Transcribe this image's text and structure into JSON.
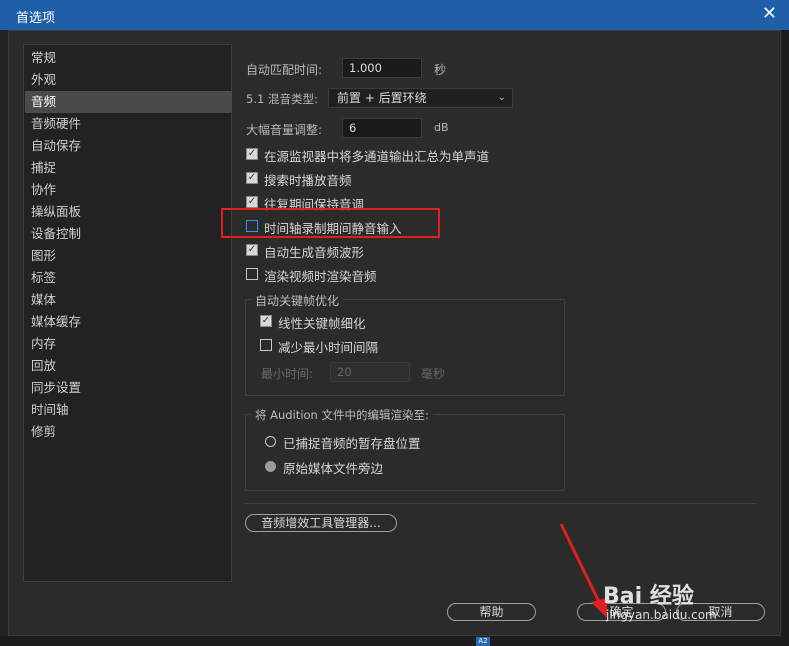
{
  "window": {
    "title": "首选项",
    "close_glyph": "✕"
  },
  "sidebar": {
    "items": [
      {
        "label": "常规",
        "selected": false
      },
      {
        "label": "外观",
        "selected": false
      },
      {
        "label": "音频",
        "selected": true
      },
      {
        "label": "音频硬件",
        "selected": false
      },
      {
        "label": "自动保存",
        "selected": false
      },
      {
        "label": "捕捉",
        "selected": false
      },
      {
        "label": "协作",
        "selected": false
      },
      {
        "label": "操纵面板",
        "selected": false
      },
      {
        "label": "设备控制",
        "selected": false
      },
      {
        "label": "图形",
        "selected": false
      },
      {
        "label": "标签",
        "selected": false
      },
      {
        "label": "媒体",
        "selected": false
      },
      {
        "label": "媒体缓存",
        "selected": false
      },
      {
        "label": "内存",
        "selected": false
      },
      {
        "label": "回放",
        "selected": false
      },
      {
        "label": "同步设置",
        "selected": false
      },
      {
        "label": "时间轴",
        "selected": false
      },
      {
        "label": "修剪",
        "selected": false
      }
    ]
  },
  "audio": {
    "auto_match": {
      "label": "自动匹配时间:",
      "value": "1.000",
      "unit": "秒"
    },
    "mix_type": {
      "label": "5.1 混音类型:",
      "value": "前置 + 后置环绕"
    },
    "large_volume": {
      "label": "大幅音量调整:",
      "value": "6",
      "unit": "dB"
    },
    "checkboxes": [
      {
        "label": "在源监视器中将多通道输出汇总为单声道",
        "checked": true
      },
      {
        "label": "搜索时播放音频",
        "checked": true
      },
      {
        "label": "往复期间保持音调",
        "checked": true
      },
      {
        "label": "时间轴录制期间静音输入",
        "checked": false
      },
      {
        "label": "自动生成音频波形",
        "checked": true
      },
      {
        "label": "渲染视频时渲染音频",
        "checked": false
      }
    ],
    "keyframe_group": {
      "title": "自动关键帧优化",
      "linear": {
        "label": "线性关键帧细化",
        "checked": true
      },
      "reduce": {
        "label": "减少最小时间间隔",
        "checked": false
      },
      "min_time": {
        "label": "最小时间:",
        "value": "20",
        "unit": "毫秒"
      }
    },
    "render_group": {
      "title": "将 Audition 文件中的编辑渲染至:",
      "options": [
        {
          "label": "已捕捉音频的暂存盘位置",
          "selected": false
        },
        {
          "label": "原始媒体文件旁边",
          "selected": true
        }
      ]
    },
    "plugin_manager_button": "音频增效工具管理器..."
  },
  "footer": {
    "help": "帮助",
    "ok": "确定",
    "cancel": "取消"
  },
  "watermark": {
    "brand": "Bai 经验",
    "url": "jingyan.baidu.com"
  },
  "bottom_tag": "A2",
  "colors": {
    "titlebar": "#1e5fa8",
    "annotation_red": "#e02020",
    "focus_blue": "#3d8ee6"
  }
}
